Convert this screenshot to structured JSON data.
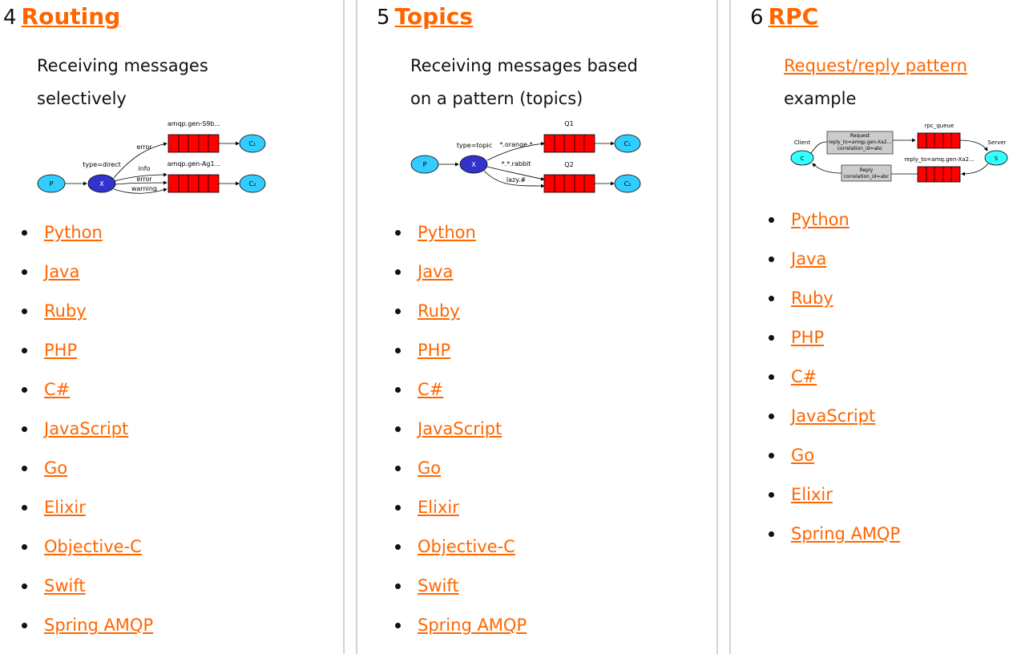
{
  "columns": [
    {
      "number": "4",
      "title": "Routing",
      "description": [
        "Receiving messages",
        "selectively"
      ],
      "diagram": {
        "producer": "P",
        "exchange": "X",
        "exchange_type": "type=direct",
        "queues": [
          "amqp.gen-S9b...",
          "amqp.gen-Ag1..."
        ],
        "consumers": [
          "C₁",
          "C₂"
        ],
        "bindings": [
          "error",
          "info",
          "error",
          "warning"
        ]
      },
      "languages": [
        "Python",
        "Java",
        "Ruby",
        "PHP",
        "C#",
        "JavaScript",
        "Go",
        "Elixir",
        "Objective-C",
        "Swift",
        "Spring AMQP"
      ]
    },
    {
      "number": "5",
      "title": "Topics",
      "description": [
        "Receiving messages based",
        "on a pattern (topics)"
      ],
      "diagram": {
        "producer": "P",
        "exchange": "X",
        "exchange_type": "type=topic",
        "queues": [
          "Q1",
          "Q2"
        ],
        "consumers": [
          "C₁",
          "C₂"
        ],
        "bindings": [
          "*.orange.*",
          "*.*.rabbit",
          "lazy.#"
        ]
      },
      "languages": [
        "Python",
        "Java",
        "Ruby",
        "PHP",
        "C#",
        "JavaScript",
        "Go",
        "Elixir",
        "Objective-C",
        "Swift",
        "Spring AMQP"
      ]
    },
    {
      "number": "6",
      "title": "RPC",
      "description_link": "Request/reply pattern",
      "description_rest": "example",
      "diagram": {
        "client_label": "Client",
        "client_node": "C",
        "server_label": "Server",
        "server_node": "S",
        "request_box": [
          "Request",
          "reply_to=amqp.gen-Xa2...",
          "correlation_id=abc"
        ],
        "reply_box": [
          "Reply",
          "correlation_id=abc"
        ],
        "rpc_queue": "rpc_queue",
        "reply_queue": "reply_to=amq.gen-Xa2..."
      },
      "languages": [
        "Python",
        "Java",
        "Ruby",
        "PHP",
        "C#",
        "JavaScript",
        "Go",
        "Elixir",
        "Spring AMQP"
      ]
    }
  ],
  "colors": {
    "link": "#ff6600",
    "queue": "#ff0000",
    "exchange": "#3333cc",
    "node": "#33ccff",
    "separator": "#d4d4d4"
  }
}
